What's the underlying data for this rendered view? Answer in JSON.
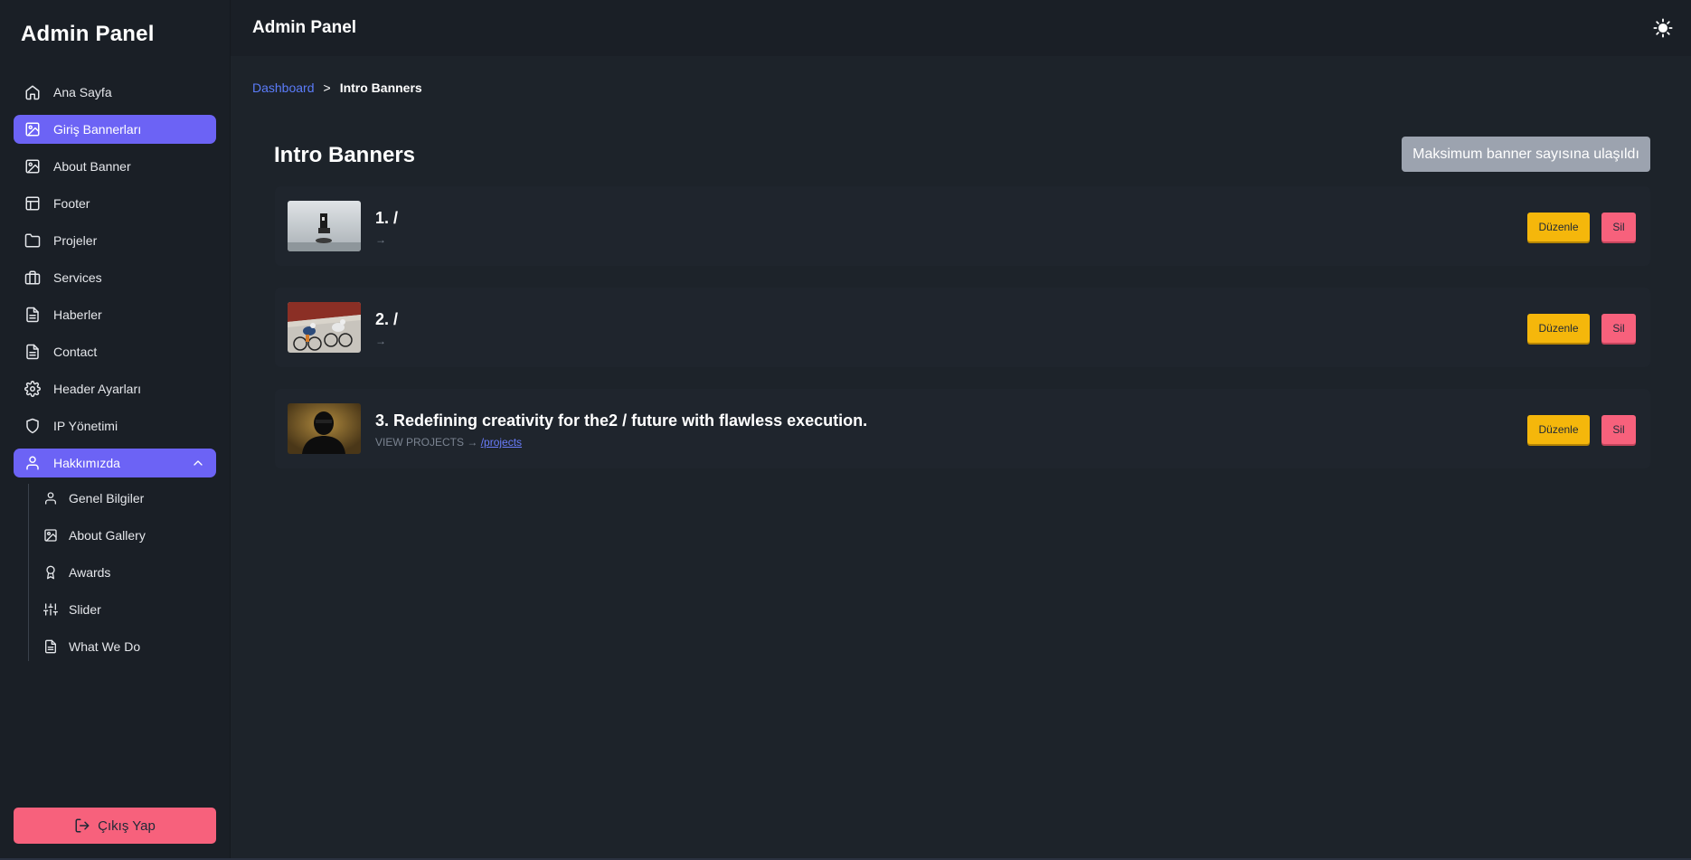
{
  "sidebar": {
    "brand": "Admin Panel",
    "items": [
      {
        "label": "Ana Sayfa",
        "icon": "home-icon"
      },
      {
        "label": "Giriş Bannerları",
        "icon": "image-icon",
        "active": true
      },
      {
        "label": "About Banner",
        "icon": "image-icon"
      },
      {
        "label": "Footer",
        "icon": "layout-icon"
      },
      {
        "label": "Projeler",
        "icon": "folder-icon"
      },
      {
        "label": "Services",
        "icon": "briefcase-icon"
      },
      {
        "label": "Haberler",
        "icon": "document-icon"
      },
      {
        "label": "Contact",
        "icon": "document-icon"
      },
      {
        "label": "Header Ayarları",
        "icon": "gear-icon"
      },
      {
        "label": "IP Yönetimi",
        "icon": "shield-icon"
      },
      {
        "label": "Hakkımızda",
        "icon": "user-icon",
        "expanded": true
      }
    ],
    "subitems": [
      {
        "label": "Genel Bilgiler",
        "icon": "user-icon"
      },
      {
        "label": "About Gallery",
        "icon": "image-icon"
      },
      {
        "label": "Awards",
        "icon": "award-icon"
      },
      {
        "label": "Slider",
        "icon": "sliders-icon"
      },
      {
        "label": "What We Do",
        "icon": "document-icon"
      }
    ],
    "logout_label": "Çıkış Yap"
  },
  "topbar": {
    "title": "Admin Panel",
    "theme_icon": "sun-icon"
  },
  "breadcrumb": {
    "link": "Dashboard",
    "separator": ">",
    "current": "Intro Banners"
  },
  "main": {
    "title": "Intro Banners",
    "max_button": "Maksimum banner sayısına ulaşıldı",
    "banners": [
      {
        "title": "1. /",
        "subtitle": "→",
        "link": ""
      },
      {
        "title": "2. /",
        "subtitle": "→",
        "link": ""
      },
      {
        "title": "3. Redefining creativity for the2 / future with flawless execution.",
        "subtitle": "VIEW PROJECTS →",
        "link": "/projects"
      }
    ],
    "edit_label": "Düzenle",
    "delete_label": "Sil"
  },
  "colors": {
    "accent": "#6c63f5",
    "danger": "#f7617c",
    "warning": "#f5b70b",
    "background": "#1d232a",
    "link": "#5b7cfa"
  }
}
